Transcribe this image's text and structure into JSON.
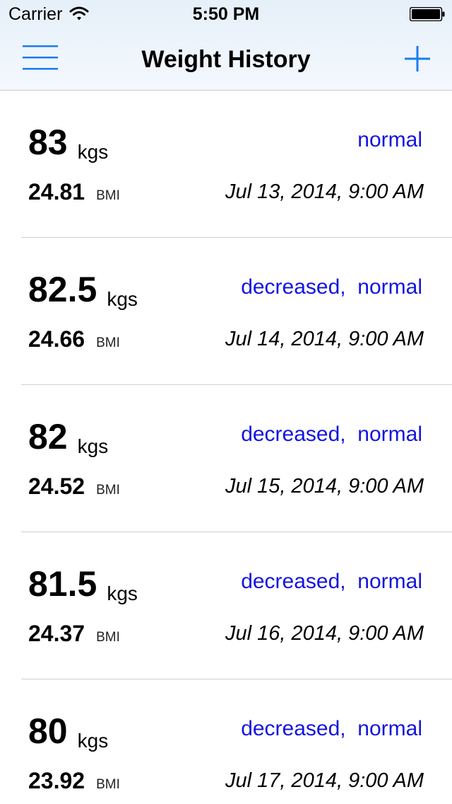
{
  "status_bar": {
    "carrier": "Carrier",
    "time": "5:50 PM"
  },
  "nav": {
    "title": "Weight History",
    "menu_icon": "hamburger-menu-icon",
    "add_icon": "plus-icon",
    "accent_color": "#1a7cf0"
  },
  "entries": [
    {
      "weight": "83",
      "unit": "kgs",
      "trend": "normal",
      "bmi": "24.81",
      "bmi_label": "BMI",
      "date": "Jul 13, 2014, 9:00 AM"
    },
    {
      "weight": "82.5",
      "unit": "kgs",
      "trend": "decreased,  normal",
      "bmi": "24.66",
      "bmi_label": "BMI",
      "date": "Jul 14, 2014, 9:00 AM"
    },
    {
      "weight": "82",
      "unit": "kgs",
      "trend": "decreased,  normal",
      "bmi": "24.52",
      "bmi_label": "BMI",
      "date": "Jul 15, 2014, 9:00 AM"
    },
    {
      "weight": "81.5",
      "unit": "kgs",
      "trend": "decreased,  normal",
      "bmi": "24.37",
      "bmi_label": "BMI",
      "date": "Jul 16, 2014, 9:00 AM"
    },
    {
      "weight": "80",
      "unit": "kgs",
      "trend": "decreased,  normal",
      "bmi": "23.92",
      "bmi_label": "BMI",
      "date": "Jul 17, 2014, 9:00 AM"
    }
  ],
  "colors": {
    "trend_text": "#1414e0",
    "separator": "#cfcfd3"
  }
}
